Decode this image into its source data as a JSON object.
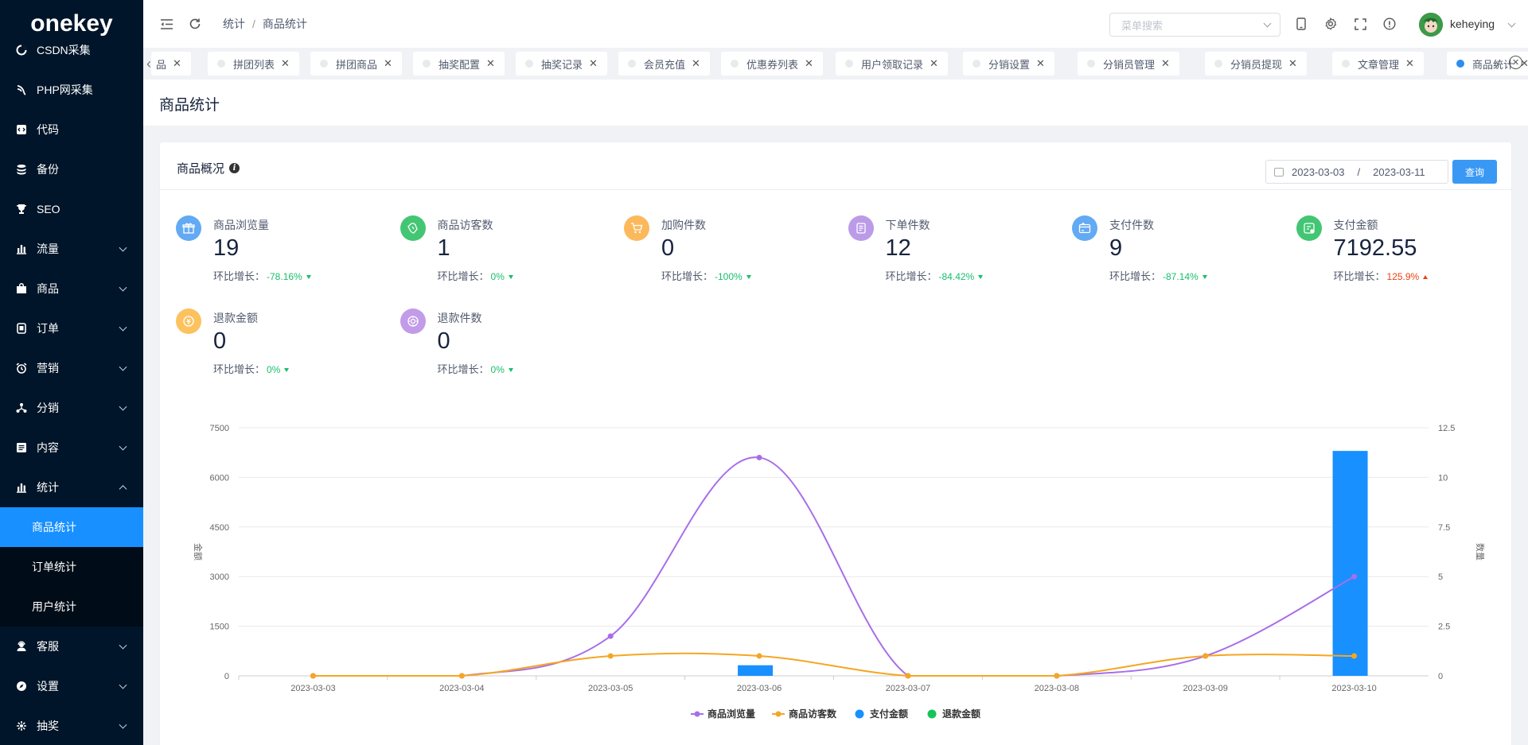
{
  "logo": "onekey",
  "sidebar": {
    "items": [
      {
        "label": "CSDN采集",
        "icon": "spin-icon",
        "hasChild": false
      },
      {
        "label": "PHP网采集",
        "icon": "spider-icon",
        "hasChild": false
      },
      {
        "label": "代码",
        "icon": "code-icon",
        "hasChild": false
      },
      {
        "label": "备份",
        "icon": "database-icon",
        "hasChild": false
      },
      {
        "label": "SEO",
        "icon": "trophy-icon",
        "hasChild": false
      },
      {
        "label": "流量",
        "icon": "bar-chart-icon",
        "hasChild": true
      },
      {
        "label": "商品",
        "icon": "shop-icon",
        "hasChild": true
      },
      {
        "label": "订单",
        "icon": "order-icon",
        "hasChild": true
      },
      {
        "label": "营销",
        "icon": "alarm-icon",
        "hasChild": true
      },
      {
        "label": "分销",
        "icon": "cluster-icon",
        "hasChild": true
      },
      {
        "label": "内容",
        "icon": "document-icon",
        "hasChild": true
      },
      {
        "label": "统计",
        "icon": "bar-chart-icon",
        "hasChild": true,
        "open": true
      }
    ],
    "stats_children": [
      "商品统计",
      "订单统计",
      "用户统计"
    ],
    "bottom_items": [
      {
        "label": "客服",
        "icon": "headset-icon"
      },
      {
        "label": "设置",
        "icon": "compass-icon"
      },
      {
        "label": "抽奖",
        "icon": "gift-icon"
      }
    ]
  },
  "header": {
    "breadcrumb": [
      "统计",
      "商品统计"
    ],
    "search_placeholder": "菜单搜索",
    "username": "keheying"
  },
  "tabs": [
    {
      "label": "商品",
      "active": false,
      "partial": true
    },
    {
      "label": "拼团列表",
      "active": false
    },
    {
      "label": "拼团商品",
      "active": false
    },
    {
      "label": "抽奖配置",
      "active": false
    },
    {
      "label": "抽奖记录",
      "active": false
    },
    {
      "label": "会员充值",
      "active": false
    },
    {
      "label": "优惠券列表",
      "active": false
    },
    {
      "label": "用户领取记录",
      "active": false
    },
    {
      "label": "分销设置",
      "active": false
    },
    {
      "label": "分销员管理",
      "active": false
    },
    {
      "label": "分销员提现",
      "active": false
    },
    {
      "label": "文章管理",
      "active": false
    },
    {
      "label": "商品统计",
      "active": true
    }
  ],
  "page": {
    "title": "商品统计",
    "card_title": "商品概况",
    "date_start": "2023-03-03",
    "date_sep": "/",
    "date_end": "2023-03-11",
    "query_label": "查询",
    "change_prefix": "环比增长："
  },
  "stats": [
    {
      "label": "商品浏览量",
      "value": "19",
      "pct": "-78.16%",
      "dir": "down",
      "color": "#62aaf3",
      "icon": "gift-icon"
    },
    {
      "label": "商品访客数",
      "value": "1",
      "pct": "0%",
      "dir": "down",
      "color": "#43c673",
      "icon": "hand-icon"
    },
    {
      "label": "加购件数",
      "value": "0",
      "pct": "-100%",
      "dir": "down",
      "color": "#fcb95c",
      "icon": "cart-icon"
    },
    {
      "label": "下单件数",
      "value": "12",
      "pct": "-84.42%",
      "dir": "down",
      "color": "#bb9be8",
      "icon": "order-icon"
    },
    {
      "label": "支付件数",
      "value": "9",
      "pct": "-87.14%",
      "dir": "down",
      "color": "#62aaf3",
      "icon": "card-icon"
    },
    {
      "label": "支付金额",
      "value": "7192.55",
      "pct": "125.9%",
      "dir": "up",
      "color": "#43c673",
      "icon": "wallet-icon"
    },
    {
      "label": "退款金额",
      "value": "0",
      "pct": "0%",
      "dir": "down",
      "color": "#fcc25f",
      "icon": "refund-icon"
    },
    {
      "label": "退款件数",
      "value": "0",
      "pct": "0%",
      "dir": "down",
      "color": "#c29be9",
      "icon": "return-icon"
    }
  ],
  "chart_data": {
    "type": "bar",
    "categories": [
      "2023-03-03",
      "2023-03-04",
      "2023-03-05",
      "2023-03-06",
      "2023-03-07",
      "2023-03-08",
      "2023-03-09",
      "2023-03-10"
    ],
    "ylabel": "金额",
    "y2label": "数量",
    "ylim": [
      0,
      7500
    ],
    "y2lim": [
      0,
      12.5
    ],
    "yticks": [
      "0",
      "1500",
      "3000",
      "4500",
      "6000",
      "7500"
    ],
    "y2ticks": [
      "0",
      "2.5",
      "5",
      "7.5",
      "10",
      "12.5"
    ],
    "legend_position": "bottom",
    "series": [
      {
        "name": "商品浏览量",
        "type": "line",
        "axis": "right",
        "color": "#a86ee8",
        "values": [
          0,
          0,
          2,
          11,
          0,
          0,
          1,
          5
        ]
      },
      {
        "name": "商品访客数",
        "type": "line",
        "axis": "right",
        "color": "#f5a623",
        "values": [
          0,
          0,
          1,
          1,
          0,
          0,
          1,
          1
        ]
      },
      {
        "name": "支付金额",
        "type": "bar",
        "axis": "left",
        "color": "#1890ff",
        "values": [
          0,
          0,
          0,
          320,
          0,
          0,
          0,
          6800
        ]
      },
      {
        "name": "退款金额",
        "type": "bar",
        "axis": "left",
        "color": "#17c35a",
        "values": [
          0,
          0,
          0,
          0,
          0,
          0,
          0,
          0
        ]
      }
    ]
  }
}
